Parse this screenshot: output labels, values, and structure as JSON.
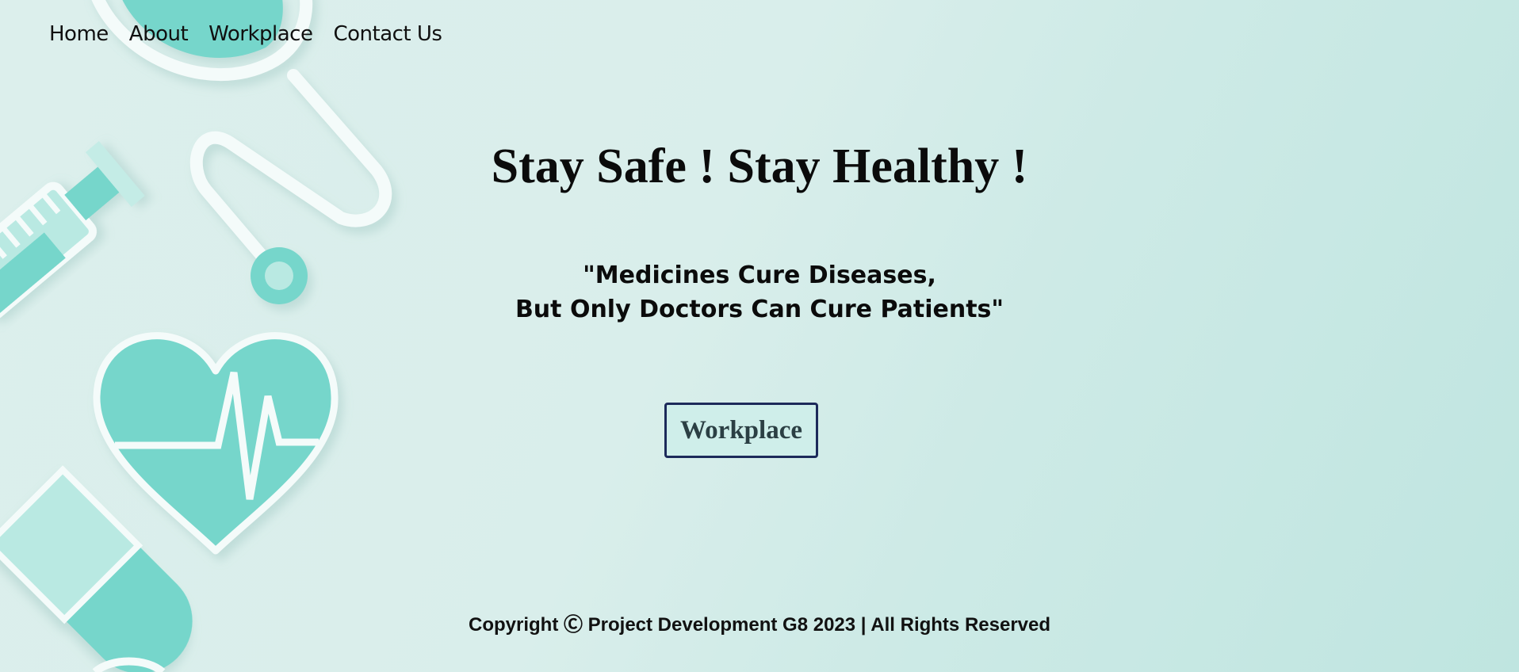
{
  "nav": {
    "items": [
      {
        "label": "Home"
      },
      {
        "label": "About"
      },
      {
        "label": "Workplace"
      },
      {
        "label": "Contact Us"
      }
    ]
  },
  "hero": {
    "headline": "Stay Safe ! Stay Healthy !",
    "quote_line1": "\"Medicines Cure Diseases,",
    "quote_line2": "But Only Doctors Can Cure Patients\"",
    "button_label": "Workplace"
  },
  "footer": {
    "copyright": "Copyright Ⓒ Project Development G8 2023 | All Rights Reserved"
  },
  "colors": {
    "background": "#d9eeeb",
    "accent_teal": "#76d6cb",
    "light_teal": "#b9e9e2",
    "button_border": "#1c2a5a"
  },
  "icons": {
    "decor": [
      "stethoscope-icon",
      "syringe-icon",
      "heart-pulse-icon",
      "pill-capsule-icon"
    ]
  }
}
